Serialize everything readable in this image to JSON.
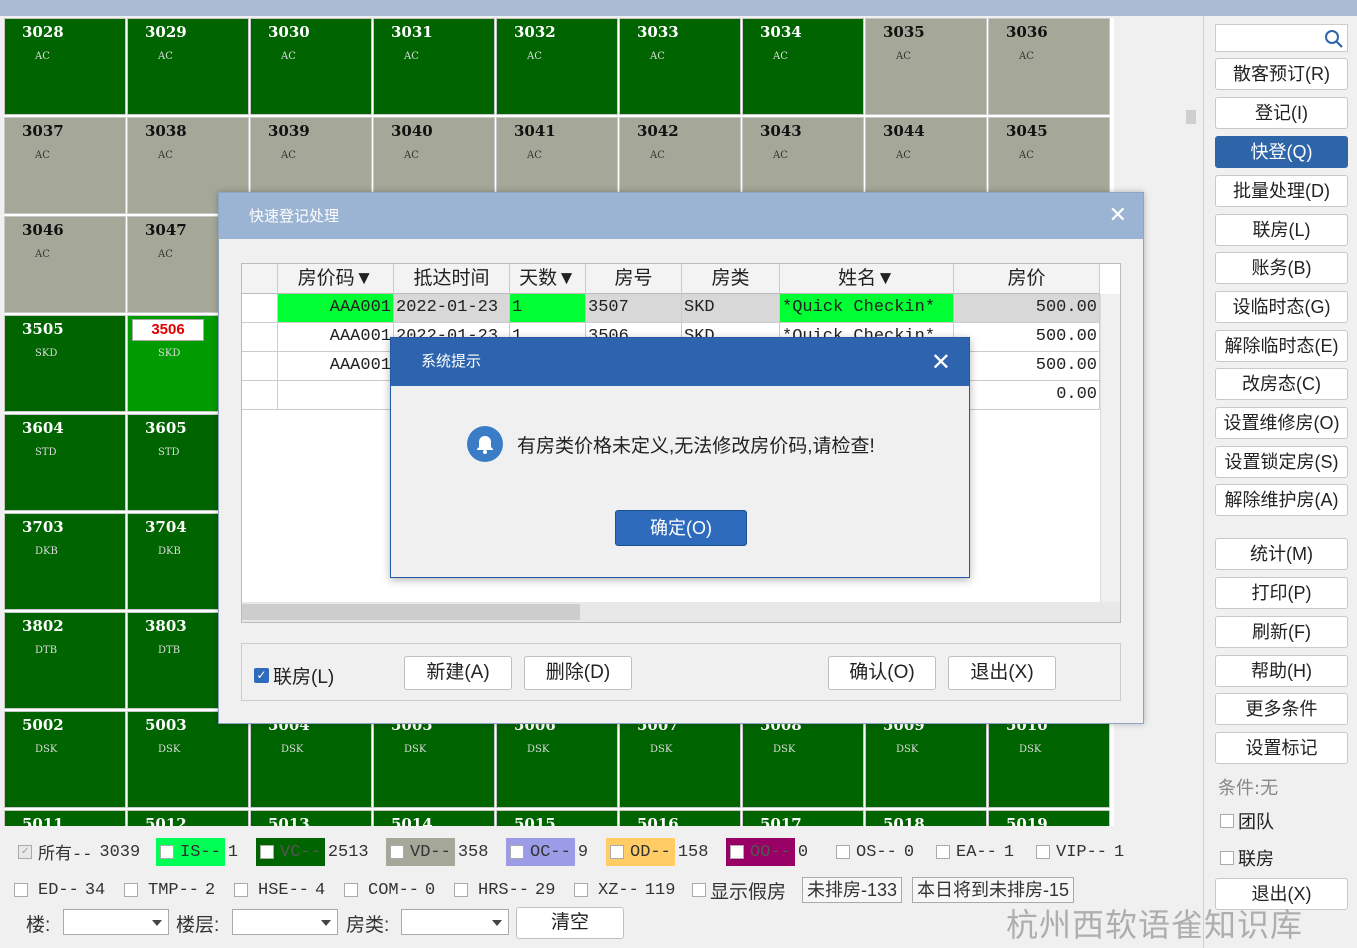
{
  "room_grid": [
    [
      {
        "num": "3028",
        "type": "AC",
        "s": "g"
      },
      {
        "num": "3029",
        "type": "AC",
        "s": "g"
      },
      {
        "num": "3030",
        "type": "AC",
        "s": "g"
      },
      {
        "num": "3031",
        "type": "AC",
        "s": "g"
      },
      {
        "num": "3032",
        "type": "AC",
        "s": "g"
      },
      {
        "num": "3033",
        "type": "AC",
        "s": "g"
      },
      {
        "num": "3034",
        "type": "AC",
        "s": "g"
      },
      {
        "num": "3035",
        "type": "AC",
        "s": "v"
      },
      {
        "num": "3036",
        "type": "AC",
        "s": "v"
      }
    ],
    [
      {
        "num": "3037",
        "type": "AC",
        "s": "v"
      },
      {
        "num": "3038",
        "type": "AC",
        "s": "v"
      },
      {
        "num": "3039",
        "type": "AC",
        "s": "v"
      },
      {
        "num": "3040",
        "type": "AC",
        "s": "v"
      },
      {
        "num": "3041",
        "type": "AC",
        "s": "v"
      },
      {
        "num": "3042",
        "type": "AC",
        "s": "v"
      },
      {
        "num": "3043",
        "type": "AC",
        "s": "v"
      },
      {
        "num": "3044",
        "type": "AC",
        "s": "v"
      },
      {
        "num": "3045",
        "type": "AC",
        "s": "v"
      }
    ],
    [
      {
        "num": "3046",
        "type": "AC",
        "s": "v"
      },
      {
        "num": "3047",
        "type": "AC",
        "s": "v"
      },
      {
        "num": "",
        "type": "",
        "s": "v"
      },
      {
        "num": "",
        "type": "",
        "s": "v"
      },
      {
        "num": "",
        "type": "",
        "s": "v"
      },
      {
        "num": "",
        "type": "",
        "s": "v"
      },
      {
        "num": "",
        "type": "",
        "s": "v"
      },
      {
        "num": "",
        "type": "",
        "s": "v"
      },
      {
        "num": "",
        "type": "",
        "s": "v"
      }
    ],
    [
      {
        "num": "3505",
        "type": "SKD",
        "s": "g"
      },
      {
        "num": "3506",
        "type": "SKD",
        "s": "b",
        "mark": true
      },
      {
        "num": "",
        "type": "",
        "s": "g"
      },
      {
        "num": "",
        "type": "",
        "s": "g"
      },
      {
        "num": "",
        "type": "",
        "s": "g"
      },
      {
        "num": "",
        "type": "",
        "s": "g"
      },
      {
        "num": "",
        "type": "",
        "s": "g"
      },
      {
        "num": "",
        "type": "",
        "s": "g"
      },
      {
        "num": "",
        "type": "",
        "s": "g"
      }
    ],
    [
      {
        "num": "3604",
        "type": "STD",
        "s": "g"
      },
      {
        "num": "3605",
        "type": "STD",
        "s": "g"
      },
      {
        "num": "",
        "type": "",
        "s": "g"
      },
      {
        "num": "",
        "type": "",
        "s": "g"
      },
      {
        "num": "",
        "type": "",
        "s": "g"
      },
      {
        "num": "",
        "type": "",
        "s": "g"
      },
      {
        "num": "",
        "type": "",
        "s": "g"
      },
      {
        "num": "",
        "type": "",
        "s": "g"
      },
      {
        "num": "",
        "type": "",
        "s": "g"
      }
    ],
    [
      {
        "num": "3703",
        "type": "DKB",
        "s": "g"
      },
      {
        "num": "3704",
        "type": "DKB",
        "s": "g"
      },
      {
        "num": "",
        "type": "",
        "s": "g"
      },
      {
        "num": "",
        "type": "",
        "s": "g"
      },
      {
        "num": "",
        "type": "",
        "s": "g"
      },
      {
        "num": "",
        "type": "",
        "s": "g"
      },
      {
        "num": "",
        "type": "",
        "s": "g"
      },
      {
        "num": "",
        "type": "",
        "s": "g"
      },
      {
        "num": "",
        "type": "",
        "s": "g"
      }
    ],
    [
      {
        "num": "3802",
        "type": "DTB",
        "s": "g"
      },
      {
        "num": "3803",
        "type": "DTB",
        "s": "g"
      },
      {
        "num": "",
        "type": "",
        "s": "g"
      },
      {
        "num": "",
        "type": "",
        "s": "g"
      },
      {
        "num": "",
        "type": "",
        "s": "g"
      },
      {
        "num": "",
        "type": "",
        "s": "g"
      },
      {
        "num": "",
        "type": "",
        "s": "g"
      },
      {
        "num": "",
        "type": "",
        "s": "g"
      },
      {
        "num": "",
        "type": "",
        "s": "g"
      }
    ],
    [
      {
        "num": "5002",
        "type": "DSK",
        "s": "g"
      },
      {
        "num": "5003",
        "type": "DSK",
        "s": "g"
      },
      {
        "num": "5004",
        "type": "DSK",
        "s": "g"
      },
      {
        "num": "5005",
        "type": "DSK",
        "s": "g"
      },
      {
        "num": "5006",
        "type": "DSK",
        "s": "g"
      },
      {
        "num": "5007",
        "type": "DSK",
        "s": "g"
      },
      {
        "num": "5008",
        "type": "DSK",
        "s": "g"
      },
      {
        "num": "5009",
        "type": "DSK",
        "s": "g"
      },
      {
        "num": "5010",
        "type": "DSK",
        "s": "g"
      }
    ],
    [
      {
        "num": "5011",
        "type": "",
        "s": "g"
      },
      {
        "num": "5012",
        "type": "",
        "s": "g"
      },
      {
        "num": "5013",
        "type": "",
        "s": "g"
      },
      {
        "num": "5014",
        "type": "",
        "s": "g"
      },
      {
        "num": "5015",
        "type": "",
        "s": "g"
      },
      {
        "num": "5016",
        "type": "",
        "s": "g"
      },
      {
        "num": "5017",
        "type": "",
        "s": "g"
      },
      {
        "num": "5018",
        "type": "",
        "s": "g"
      },
      {
        "num": "5019",
        "type": "",
        "s": "g"
      }
    ]
  ],
  "sidebar": {
    "buttons": [
      "散客预订(R)",
      "登记(I)",
      "快登(Q)",
      "批量处理(D)",
      "联房(L)",
      "账务(B)",
      "设临时态(G)",
      "解除临时态(E)",
      "改房态(C)",
      "设置维修房(O)",
      "设置锁定房(S)",
      "解除维护房(A)",
      "统计(M)",
      "打印(P)",
      "刷新(F)",
      "帮助(H)",
      "更多条件",
      "设置标记"
    ],
    "active": "快登(Q)",
    "condition": "条件:无",
    "team": "团队",
    "link_room": "联房",
    "exit": "退出(X)"
  },
  "legend": {
    "row1": [
      {
        "label": "所有--",
        "count": "3039",
        "color": "",
        "checked": true
      },
      {
        "label": "IS--",
        "count": "1",
        "color": "#00ff55"
      },
      {
        "label": "VC--",
        "count": "2513",
        "color": "#006400"
      },
      {
        "label": "VD--",
        "count": "358",
        "color": "#a5a898"
      },
      {
        "label": "OC--",
        "count": "9",
        "color": "#9b9be8"
      },
      {
        "label": "OD--",
        "count": "158",
        "color": "#ffcc66"
      },
      {
        "label": "OO--",
        "count": "0",
        "color": "#990066"
      },
      {
        "label": "OS--",
        "count": "0",
        "color": ""
      },
      {
        "label": "EA--",
        "count": "1",
        "color": ""
      },
      {
        "label": "VIP--",
        "count": "1",
        "color": ""
      }
    ],
    "row2": [
      {
        "label": "ED--",
        "count": "34"
      },
      {
        "label": "TMP--",
        "count": "2"
      },
      {
        "label": "HSE--",
        "count": "4"
      },
      {
        "label": "COM--",
        "count": "0"
      },
      {
        "label": "HRS--",
        "count": "29"
      },
      {
        "label": "XZ--",
        "count": "119"
      }
    ],
    "show_fake": "显示假房",
    "unassigned": "未排房-133",
    "today_unassigned": "本日将到未排房-15",
    "building_label": "楼:",
    "floor_label": "楼层:",
    "roomtype_label": "房类:",
    "clear": "清空"
  },
  "dialog": {
    "title": "快速登记处理",
    "headers": [
      "房价码▼",
      "抵达时间",
      "天数▼",
      "房号",
      "房类",
      "姓名▼",
      "房价"
    ],
    "rows": [
      [
        "AAA001",
        "2022-01-23",
        "1",
        "3507",
        "SKD",
        "*Quick Checkin*",
        "500.00"
      ],
      [
        "AAA001",
        "2022-01-23",
        "1",
        "3506",
        "SKD",
        "*Quick Checkin*",
        "500.00"
      ],
      [
        "AAA001",
        "",
        "",
        "",
        "",
        "",
        "500.00"
      ],
      [
        "",
        "",
        "",
        "",
        "",
        "",
        "0.00"
      ]
    ],
    "link_room": "联房(L)",
    "new": "新建(A)",
    "delete": "删除(D)",
    "confirm": "确认(O)",
    "exit": "退出(X)"
  },
  "alert": {
    "title": "系统提示",
    "message": "有房类价格未定义,无法修改房价码,请检查!",
    "ok": "确定(O)"
  },
  "watermark": "杭州西软语雀知识库"
}
